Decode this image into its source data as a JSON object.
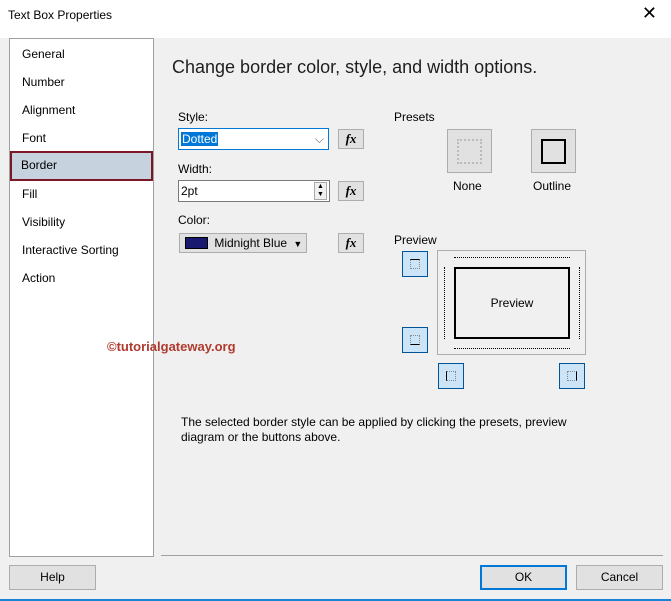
{
  "window": {
    "title": "Text Box Properties"
  },
  "sidebar": {
    "items": [
      {
        "label": "General"
      },
      {
        "label": "Number"
      },
      {
        "label": "Alignment"
      },
      {
        "label": "Font"
      },
      {
        "label": "Border"
      },
      {
        "label": "Fill"
      },
      {
        "label": "Visibility"
      },
      {
        "label": "Interactive Sorting"
      },
      {
        "label": "Action"
      }
    ],
    "selected": "Border"
  },
  "main": {
    "heading": "Change border color, style, and width options.",
    "style": {
      "label": "Style:",
      "value": "Dotted"
    },
    "width": {
      "label": "Width:",
      "value": "2pt"
    },
    "color": {
      "label": "Color:",
      "value": "Midnight Blue",
      "swatch": "#191970"
    },
    "fx_label": "fx",
    "presets": {
      "label": "Presets",
      "none": "None",
      "outline": "Outline"
    },
    "preview": {
      "label": "Preview",
      "text": "Preview"
    },
    "help_text": "The selected border style can be applied by clicking the presets, preview diagram or the buttons above."
  },
  "watermark": "©tutorialgateway.org",
  "buttons": {
    "help": "Help",
    "ok": "OK",
    "cancel": "Cancel"
  }
}
